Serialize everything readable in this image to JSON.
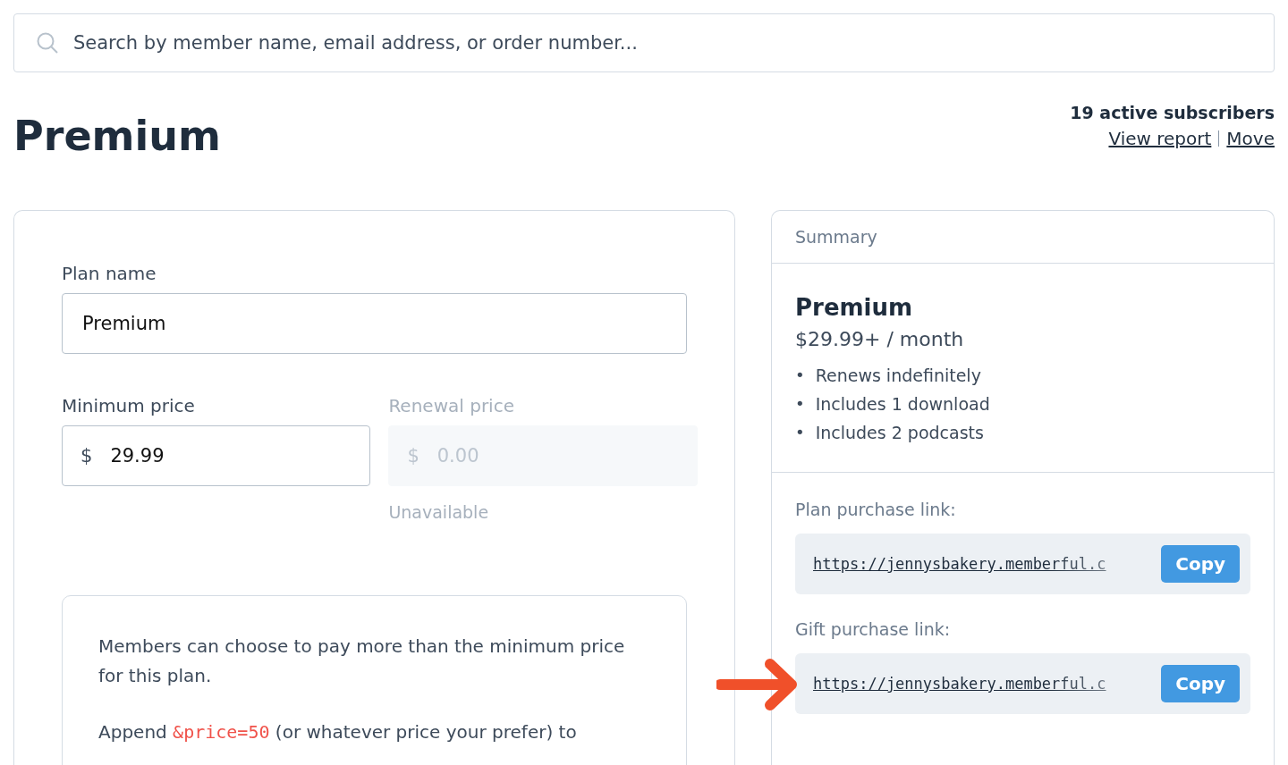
{
  "search": {
    "placeholder": "Search by member name, email address, or order number..."
  },
  "header": {
    "title": "Premium",
    "subscribers": "19 active subscribers",
    "links": [
      "View report",
      "Move"
    ]
  },
  "form": {
    "plan_name": {
      "label": "Plan name",
      "value": "Premium"
    },
    "minimum_price": {
      "label": "Minimum price",
      "currency": "$",
      "value": "29.99",
      "disabled": false
    },
    "renewal_price": {
      "label": "Renewal price",
      "currency": "$",
      "placeholder": "0.00",
      "disabled": true,
      "note": "Unavailable"
    },
    "info": {
      "text": "Members can choose to pay more than the minimum price for this plan.",
      "append_before": "Append",
      "append_code": "&price=50",
      "append_after": "(or whatever price your prefer) to"
    }
  },
  "summary": {
    "heading": "Summary",
    "plan": "Premium",
    "price": "$29.99+ / month",
    "bullet": "•",
    "features": [
      "Renews indefinitely",
      "Includes 1 download",
      "Includes 2 podcasts"
    ],
    "links": [
      {
        "label": "Plan purchase link:",
        "url": "https://jennysbakery.memberful.c",
        "button": "Copy",
        "highlighted": false
      },
      {
        "label": "Gift purchase link:",
        "url": "https://jennysbakery.memberful.c",
        "button": "Copy",
        "highlighted": true
      }
    ]
  }
}
